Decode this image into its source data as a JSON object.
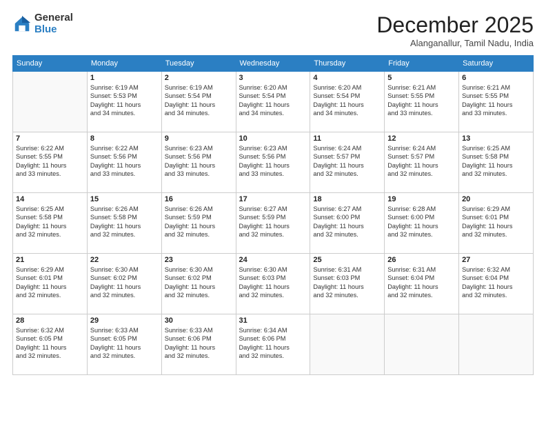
{
  "logo": {
    "general": "General",
    "blue": "Blue"
  },
  "title": "December 2025",
  "location": "Alanganallur, Tamil Nadu, India",
  "weekdays": [
    "Sunday",
    "Monday",
    "Tuesday",
    "Wednesday",
    "Thursday",
    "Friday",
    "Saturday"
  ],
  "weeks": [
    [
      {
        "day": "",
        "info": ""
      },
      {
        "day": "1",
        "info": "Sunrise: 6:19 AM\nSunset: 5:53 PM\nDaylight: 11 hours\nand 34 minutes."
      },
      {
        "day": "2",
        "info": "Sunrise: 6:19 AM\nSunset: 5:54 PM\nDaylight: 11 hours\nand 34 minutes."
      },
      {
        "day": "3",
        "info": "Sunrise: 6:20 AM\nSunset: 5:54 PM\nDaylight: 11 hours\nand 34 minutes."
      },
      {
        "day": "4",
        "info": "Sunrise: 6:20 AM\nSunset: 5:54 PM\nDaylight: 11 hours\nand 34 minutes."
      },
      {
        "day": "5",
        "info": "Sunrise: 6:21 AM\nSunset: 5:55 PM\nDaylight: 11 hours\nand 33 minutes."
      },
      {
        "day": "6",
        "info": "Sunrise: 6:21 AM\nSunset: 5:55 PM\nDaylight: 11 hours\nand 33 minutes."
      }
    ],
    [
      {
        "day": "7",
        "info": "Sunrise: 6:22 AM\nSunset: 5:55 PM\nDaylight: 11 hours\nand 33 minutes."
      },
      {
        "day": "8",
        "info": "Sunrise: 6:22 AM\nSunset: 5:56 PM\nDaylight: 11 hours\nand 33 minutes."
      },
      {
        "day": "9",
        "info": "Sunrise: 6:23 AM\nSunset: 5:56 PM\nDaylight: 11 hours\nand 33 minutes."
      },
      {
        "day": "10",
        "info": "Sunrise: 6:23 AM\nSunset: 5:56 PM\nDaylight: 11 hours\nand 33 minutes."
      },
      {
        "day": "11",
        "info": "Sunrise: 6:24 AM\nSunset: 5:57 PM\nDaylight: 11 hours\nand 32 minutes."
      },
      {
        "day": "12",
        "info": "Sunrise: 6:24 AM\nSunset: 5:57 PM\nDaylight: 11 hours\nand 32 minutes."
      },
      {
        "day": "13",
        "info": "Sunrise: 6:25 AM\nSunset: 5:58 PM\nDaylight: 11 hours\nand 32 minutes."
      }
    ],
    [
      {
        "day": "14",
        "info": "Sunrise: 6:25 AM\nSunset: 5:58 PM\nDaylight: 11 hours\nand 32 minutes."
      },
      {
        "day": "15",
        "info": "Sunrise: 6:26 AM\nSunset: 5:58 PM\nDaylight: 11 hours\nand 32 minutes."
      },
      {
        "day": "16",
        "info": "Sunrise: 6:26 AM\nSunset: 5:59 PM\nDaylight: 11 hours\nand 32 minutes."
      },
      {
        "day": "17",
        "info": "Sunrise: 6:27 AM\nSunset: 5:59 PM\nDaylight: 11 hours\nand 32 minutes."
      },
      {
        "day": "18",
        "info": "Sunrise: 6:27 AM\nSunset: 6:00 PM\nDaylight: 11 hours\nand 32 minutes."
      },
      {
        "day": "19",
        "info": "Sunrise: 6:28 AM\nSunset: 6:00 PM\nDaylight: 11 hours\nand 32 minutes."
      },
      {
        "day": "20",
        "info": "Sunrise: 6:29 AM\nSunset: 6:01 PM\nDaylight: 11 hours\nand 32 minutes."
      }
    ],
    [
      {
        "day": "21",
        "info": "Sunrise: 6:29 AM\nSunset: 6:01 PM\nDaylight: 11 hours\nand 32 minutes."
      },
      {
        "day": "22",
        "info": "Sunrise: 6:30 AM\nSunset: 6:02 PM\nDaylight: 11 hours\nand 32 minutes."
      },
      {
        "day": "23",
        "info": "Sunrise: 6:30 AM\nSunset: 6:02 PM\nDaylight: 11 hours\nand 32 minutes."
      },
      {
        "day": "24",
        "info": "Sunrise: 6:30 AM\nSunset: 6:03 PM\nDaylight: 11 hours\nand 32 minutes."
      },
      {
        "day": "25",
        "info": "Sunrise: 6:31 AM\nSunset: 6:03 PM\nDaylight: 11 hours\nand 32 minutes."
      },
      {
        "day": "26",
        "info": "Sunrise: 6:31 AM\nSunset: 6:04 PM\nDaylight: 11 hours\nand 32 minutes."
      },
      {
        "day": "27",
        "info": "Sunrise: 6:32 AM\nSunset: 6:04 PM\nDaylight: 11 hours\nand 32 minutes."
      }
    ],
    [
      {
        "day": "28",
        "info": "Sunrise: 6:32 AM\nSunset: 6:05 PM\nDaylight: 11 hours\nand 32 minutes."
      },
      {
        "day": "29",
        "info": "Sunrise: 6:33 AM\nSunset: 6:05 PM\nDaylight: 11 hours\nand 32 minutes."
      },
      {
        "day": "30",
        "info": "Sunrise: 6:33 AM\nSunset: 6:06 PM\nDaylight: 11 hours\nand 32 minutes."
      },
      {
        "day": "31",
        "info": "Sunrise: 6:34 AM\nSunset: 6:06 PM\nDaylight: 11 hours\nand 32 minutes."
      },
      {
        "day": "",
        "info": ""
      },
      {
        "day": "",
        "info": ""
      },
      {
        "day": "",
        "info": ""
      }
    ]
  ]
}
